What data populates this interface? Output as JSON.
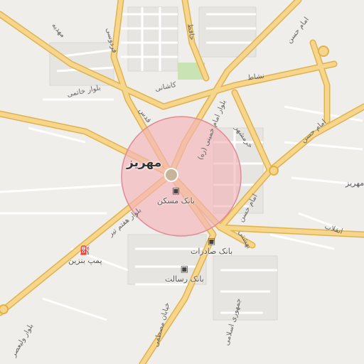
{
  "map": {
    "city_label": "مهریز",
    "city_label_small": "مهریز",
    "accent": "#f0c060",
    "radius_fill": "#f3b3b8",
    "radius_stroke": "#e08b94"
  },
  "roads": {
    "boulevard_khomeini": "بلوار امام خمینی (ره)",
    "boulevard_haftom_tir": "بلوار هفتم تیر",
    "boulevard_khatami": "بلوار خاتمی",
    "boulevard_valiasr": "بلوار ولیعصر",
    "imam_hasan_1": "امام حسن",
    "imam_hasan_2": "امام حسن",
    "imam_hasan_3": "امام حسن",
    "kashani": "کاشانی",
    "neshat": "نشاط",
    "enghelab": "انقلاب",
    "khorramshahr": "خرمشهر",
    "beheshti": "بهشتی",
    "ferdowsi": "فردوسی",
    "ghods": "قدس",
    "hafez": "حافظ",
    "mahdieh": "مهدیه",
    "mostafa": "خیابان مصطفی",
    "jomhuri": "جمهوری اسلامی"
  },
  "pois": [
    {
      "name": "بانک مسکن",
      "icon": "bank-icon"
    },
    {
      "name": "بانک صادرات",
      "icon": "bank-icon"
    },
    {
      "name": "بانک رسالت",
      "icon": "bank-icon"
    },
    {
      "name": "پمپ بنزین",
      "icon": "fuel-icon"
    }
  ]
}
